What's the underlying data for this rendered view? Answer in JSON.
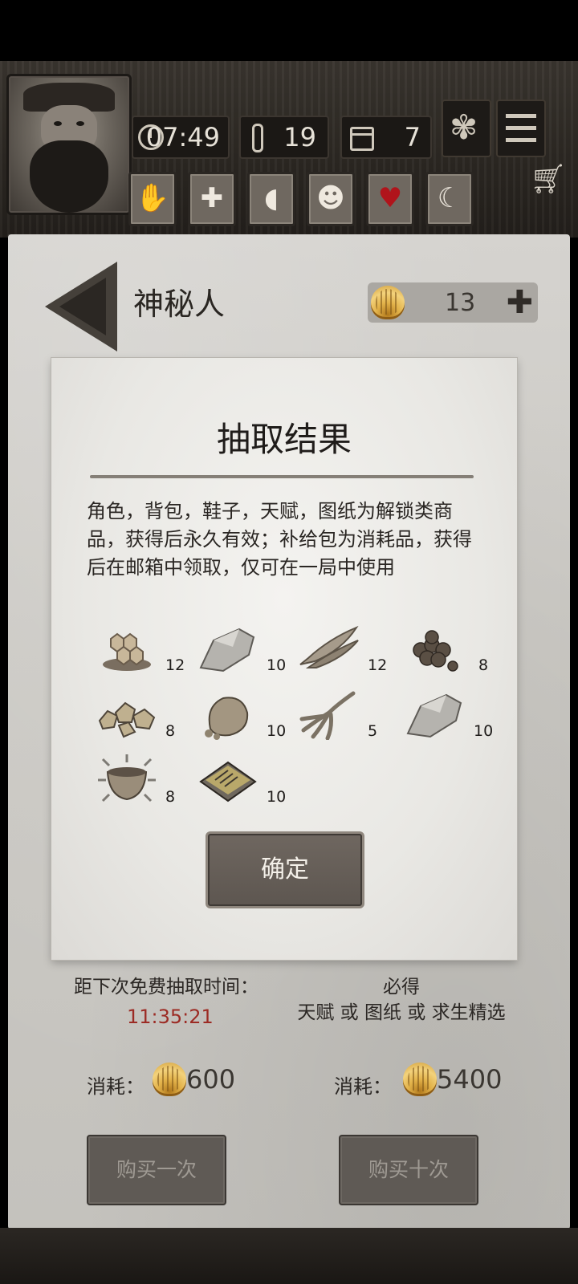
{
  "hud": {
    "time": "07:49",
    "temperature": "19",
    "day": "7",
    "icons": {
      "clock": "clock-icon",
      "temperature": "thermometer-icon",
      "day": "calendar-icon",
      "talent": "leaf-icon",
      "menu": "menu-icon",
      "cart": "cart-icon"
    },
    "status_icons": [
      "hand-bandage-icon",
      "health-cross-icon",
      "stomach-icon",
      "head-icon",
      "heart-icon",
      "moon-icon"
    ]
  },
  "shop": {
    "title": "神秘人",
    "currency": "13"
  },
  "dialog": {
    "title": "抽取结果",
    "notice": "角色，背包，鞋子，天赋，图纸为解锁类商品，获得后永久有效；补给包为消耗品，获得后在邮箱中领取，仅可在一局中使用",
    "items": [
      {
        "icon": "honeycomb-icon",
        "qty": "12"
      },
      {
        "icon": "flint-stone-icon",
        "qty": "10"
      },
      {
        "icon": "dried-fish-icon",
        "qty": "12"
      },
      {
        "icon": "nuts-icon",
        "qty": "8"
      },
      {
        "icon": "gold-ore-icon",
        "qty": "8"
      },
      {
        "icon": "stone-rock-icon",
        "qty": "10"
      },
      {
        "icon": "ginseng-root-icon",
        "qty": "5"
      },
      {
        "icon": "flint-stone-icon",
        "qty": "10"
      },
      {
        "icon": "bowl-icon",
        "qty": "8"
      },
      {
        "icon": "blueprint-book-icon",
        "qty": "10"
      }
    ],
    "confirm": "确定"
  },
  "bottom": {
    "free_label": "距下次免费抽取时间：",
    "free_timer": "11:35:21",
    "guarantee_title": "必得",
    "guarantee_text": "天赋 或 图纸 或 求生精选",
    "cost_label": "消耗：",
    "cost_single": "600",
    "cost_ten": "5400",
    "buy_once": "购买一次",
    "buy_ten": "购买十次"
  }
}
